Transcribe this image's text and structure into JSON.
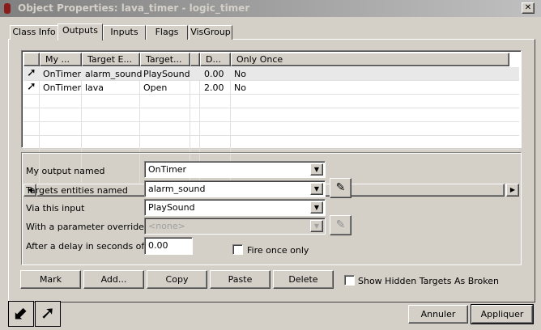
{
  "window": {
    "title": "Object Properties: lava_timer - logic_timer",
    "close": "✕"
  },
  "tabs": [
    {
      "label": "Class Info"
    },
    {
      "label": "Outputs"
    },
    {
      "label": "Inputs"
    },
    {
      "label": "Flags"
    },
    {
      "label": "VisGroup"
    }
  ],
  "list": {
    "columns": [
      "",
      "My ...",
      "Target E...",
      "Target...",
      "",
      "D...",
      "Only Once"
    ],
    "rows": [
      {
        "output": "OnTimer",
        "target": "alarm_sound",
        "input": "PlaySound",
        "delay": "0.00",
        "once": "No"
      },
      {
        "output": "OnTimer",
        "target": "lava",
        "input": "Open",
        "delay": "2.00",
        "once": "No"
      }
    ]
  },
  "form": {
    "output_label": "My output named",
    "output_value": "OnTimer",
    "targets_label": "Targets entities named",
    "targets_value": "alarm_sound",
    "input_label": "Via this input",
    "input_value": "PlaySound",
    "param_label": "With a parameter override",
    "param_value": "<none>",
    "delay_label": "After a delay in seconds of",
    "delay_value": "0.00",
    "fire_once_label": "Fire once only",
    "fire_once_checked": false
  },
  "buttons": {
    "mark": "Mark",
    "add": "Add...",
    "copy": "Copy",
    "paste": "Paste",
    "delete": "Delete"
  },
  "show_hidden": {
    "label": "Show Hidden Targets As Broken",
    "checked": false
  },
  "footer": {
    "cancel": "Annuler",
    "apply": "Appliquer"
  }
}
